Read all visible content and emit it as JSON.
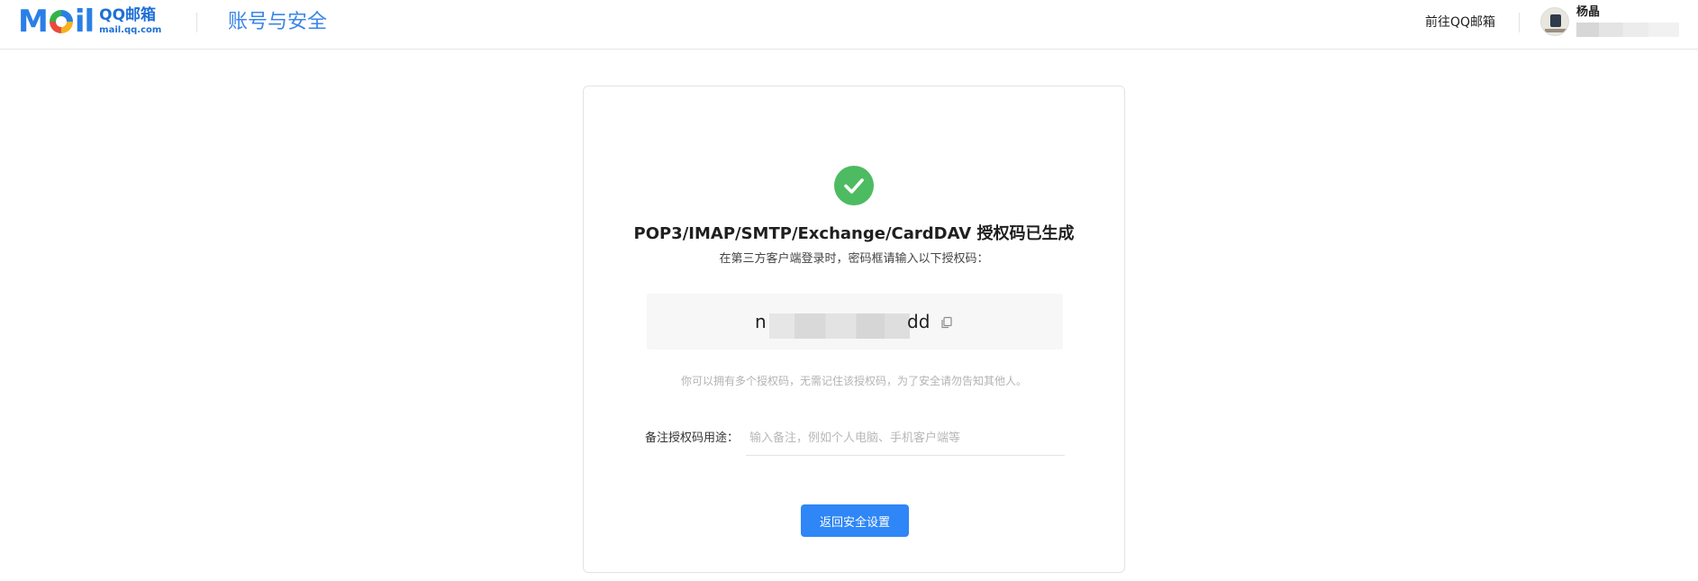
{
  "header": {
    "logo": {
      "mark": "Mail",
      "cn": "QQ邮箱",
      "en": "mail.qq.com"
    },
    "page_name": "账号与安全",
    "goto_link": "前往QQ邮箱",
    "user": {
      "name": "杨晶"
    }
  },
  "card": {
    "title": "POP3/IMAP/SMTP/Exchange/CardDAV 授权码已生成",
    "subtitle": "在第三方客户端登录时，密码框请输入以下授权码：",
    "code_prefix": "n",
    "code_suffix": "dd",
    "hint": "你可以拥有多个授权码，无需记住该授权码，为了安全请勿告知其他人。",
    "note_label": "备注授权码用途：",
    "note_placeholder": "输入备注，例如个人电脑、手机客户端等",
    "back_button": "返回安全设置"
  },
  "colors": {
    "brand_blue": "#2a7fe6",
    "success_green": "#4dbb61",
    "button_blue": "#2f86f6"
  },
  "icons": {
    "success": "check-circle-icon",
    "copy": "copy-icon"
  }
}
